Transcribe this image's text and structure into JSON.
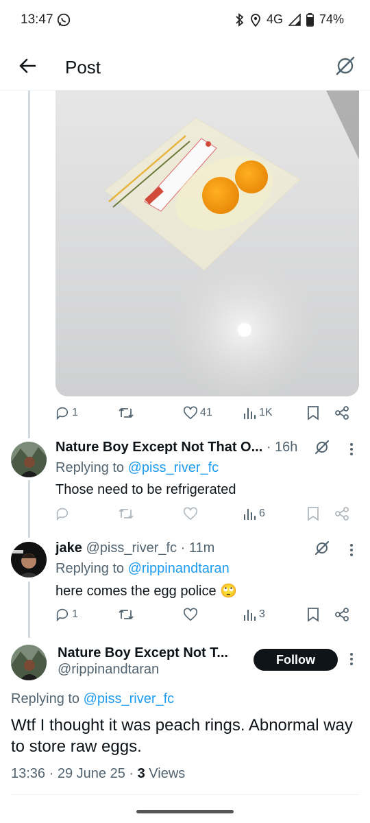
{
  "status_bar": {
    "time": "13:47",
    "network": "4G",
    "battery": "74%"
  },
  "header": {
    "title": "Post"
  },
  "post_actions": {
    "replies": "1",
    "retweets": "",
    "likes": "41",
    "views": "1K"
  },
  "replies": [
    {
      "name": "Nature Boy Except Not That O...",
      "time": "16h",
      "replying_label": "Replying to ",
      "replying_to": "@piss_river_fc",
      "text": "Those need to be refrigerated",
      "actions": {
        "replies": "",
        "likes": "",
        "views": "6"
      }
    },
    {
      "name": "jake",
      "handle": "@piss_river_fc",
      "time": "11m",
      "replying_label": "Replying to ",
      "replying_to": "@rippinandtaran",
      "text": "here comes the egg police 🙄",
      "actions": {
        "replies": "1",
        "likes": "",
        "views": "3"
      }
    }
  ],
  "main_tweet": {
    "name": "Nature Boy Except Not T...",
    "handle": "@rippinandtaran",
    "follow_label": "Follow",
    "replying_label": "Replying to ",
    "replying_to": "@piss_river_fc",
    "text": "Wtf I thought it was peach rings. Abnormal way to store raw eggs.",
    "time": "13:36",
    "date": "29 June 25",
    "views_count": "3",
    "views_label": "Views"
  },
  "icons": {
    "back": "arrow-left-icon",
    "grok": "grok-icon",
    "reply": "reply-icon",
    "retweet": "retweet-icon",
    "like": "heart-icon",
    "views": "views-icon",
    "bookmark": "bookmark-icon",
    "share": "share-icon",
    "more": "more-vertical-icon"
  },
  "colors": {
    "link": "#1d9bf0",
    "text": "#0f1419",
    "muted": "#536471",
    "follow_bg": "#0f1419"
  }
}
